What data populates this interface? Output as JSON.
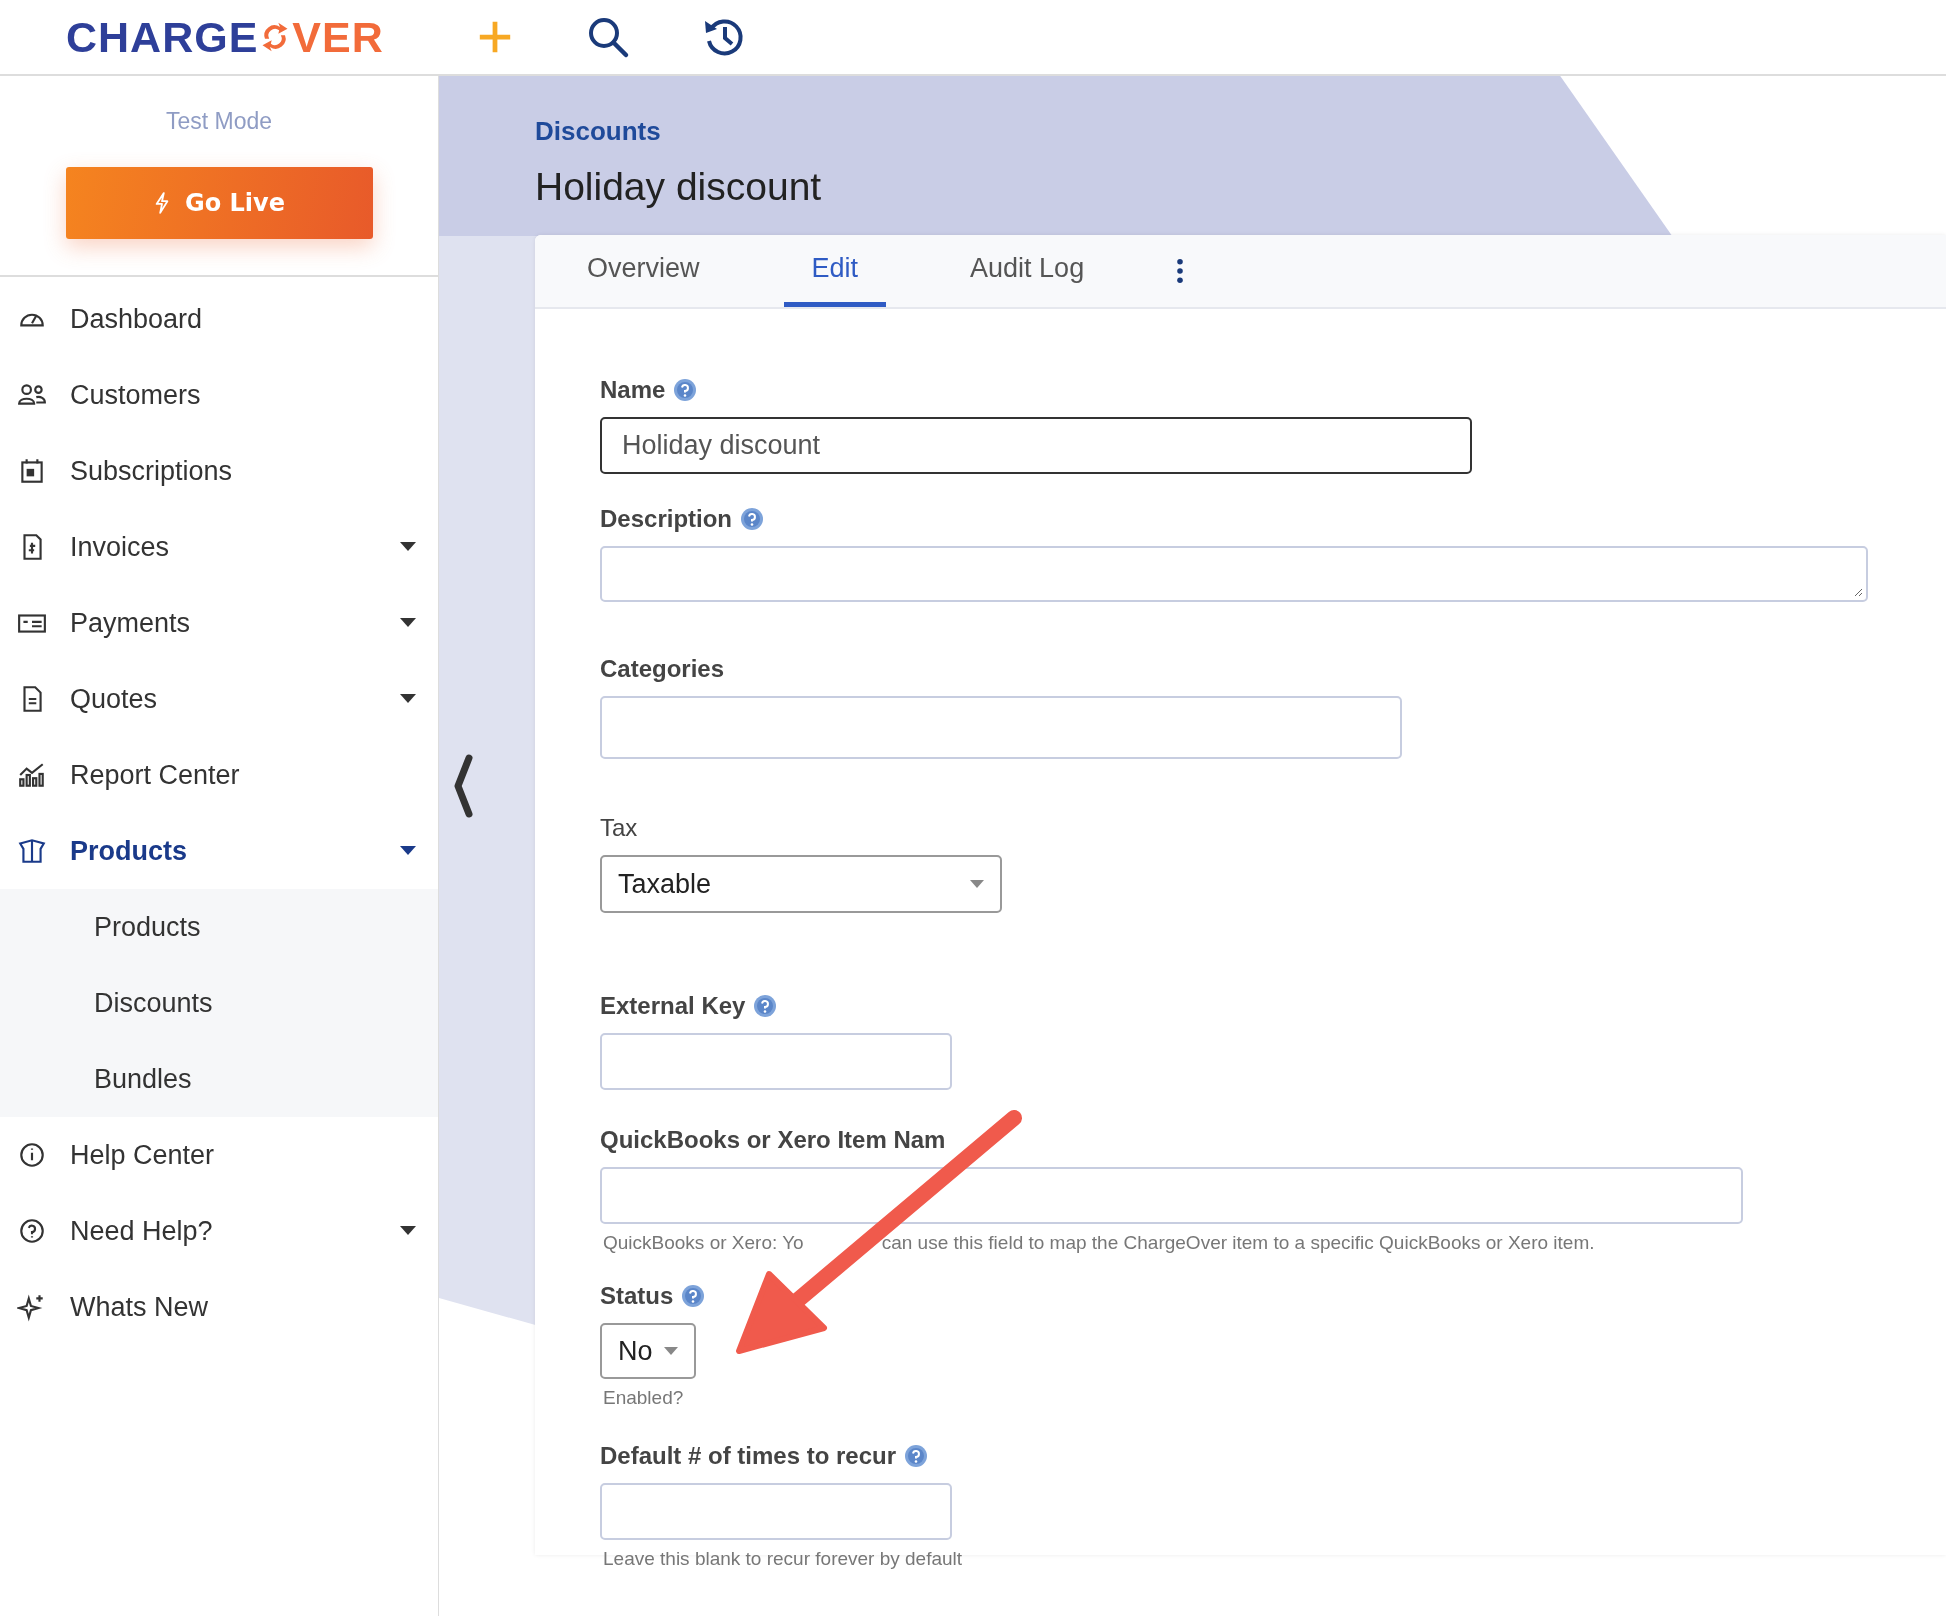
{
  "header": {
    "logo_left": "CHARGE",
    "logo_right": "VER"
  },
  "sidebar": {
    "mode": "Test Mode",
    "go_live": "Go Live",
    "items": [
      {
        "label": "Dashboard",
        "dropdown": false,
        "selected": false
      },
      {
        "label": "Customers",
        "dropdown": false,
        "selected": false
      },
      {
        "label": "Subscriptions",
        "dropdown": false,
        "selected": false
      },
      {
        "label": "Invoices",
        "dropdown": true,
        "selected": false
      },
      {
        "label": "Payments",
        "dropdown": true,
        "selected": false
      },
      {
        "label": "Quotes",
        "dropdown": true,
        "selected": false
      },
      {
        "label": "Report Center",
        "dropdown": false,
        "selected": false
      },
      {
        "label": "Products",
        "dropdown": true,
        "selected": true,
        "children": [
          {
            "label": "Products"
          },
          {
            "label": "Discounts"
          },
          {
            "label": "Bundles"
          }
        ]
      },
      {
        "label": "Help Center",
        "dropdown": false,
        "selected": false
      },
      {
        "label": "Need Help?",
        "dropdown": true,
        "selected": false
      },
      {
        "label": "Whats New",
        "dropdown": false,
        "selected": false
      }
    ]
  },
  "breadcrumb": "Discounts",
  "title": "Holiday discount",
  "tabs": [
    {
      "label": "Overview",
      "selected": false
    },
    {
      "label": "Edit",
      "selected": true
    },
    {
      "label": "Audit Log",
      "selected": false
    }
  ],
  "fields": [
    {
      "kind": "text",
      "label": "Name",
      "help": true,
      "value": "Holiday discount"
    },
    {
      "kind": "textarea",
      "label": "Description",
      "help": true
    },
    {
      "kind": "text",
      "label": "Categories",
      "help": false
    },
    {
      "kind": "select",
      "label": "Tax",
      "help": false,
      "value": "Taxable"
    },
    {
      "kind": "text",
      "label": "External Key",
      "help": true
    },
    {
      "kind": "text",
      "label": "QuickBooks or Xero Item Nam",
      "help": false,
      "hint": [
        "QuickBooks or Xero: Yo",
        "can use this field to map the ChargeOver item to a specific QuickBooks or Xero item."
      ]
    },
    {
      "kind": "select",
      "label": "Status",
      "help": true,
      "value": "No",
      "hint": [
        "Enabled?"
      ]
    },
    {
      "kind": "text",
      "label": "Default # of times to recur",
      "help": true,
      "hint": [
        "Leave this blank to recur forever by default"
      ]
    }
  ]
}
